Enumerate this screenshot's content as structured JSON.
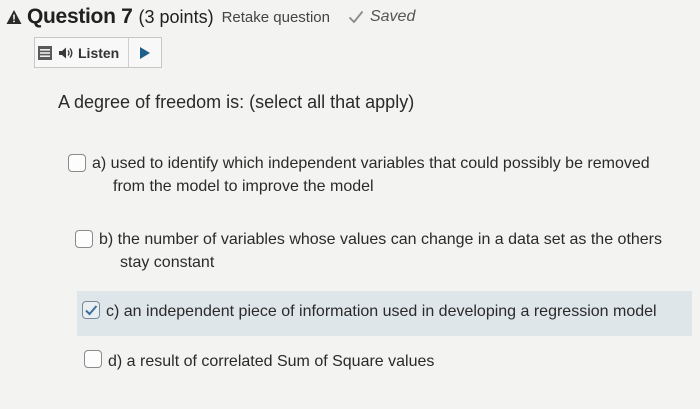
{
  "header": {
    "question_title": "Question 7",
    "points": "(3 points)",
    "retake": "Retake question",
    "saved": "Saved"
  },
  "listen": {
    "label": "Listen"
  },
  "question": {
    "prompt": "A degree of freedom is: (select all that apply)"
  },
  "options": [
    {
      "line1": "a) used to identify which independent variables that could possibly be removed",
      "line2": "from the model to improve the model",
      "checked": false
    },
    {
      "line1": "b) the number of variables whose values can change in a data set as the others",
      "line2": "stay constant",
      "checked": false
    },
    {
      "line1": "c) an independent piece of information used in developing a regression model",
      "checked": true
    },
    {
      "line1": "d) a result of correlated Sum of Square values",
      "checked": false
    }
  ],
  "colors": {
    "selected_band": "#dfe6ea",
    "background": "#f3f3f1"
  },
  "icons": [
    "warning-icon",
    "checkmark-icon",
    "menu-icon",
    "speaker-icon",
    "play-icon"
  ]
}
